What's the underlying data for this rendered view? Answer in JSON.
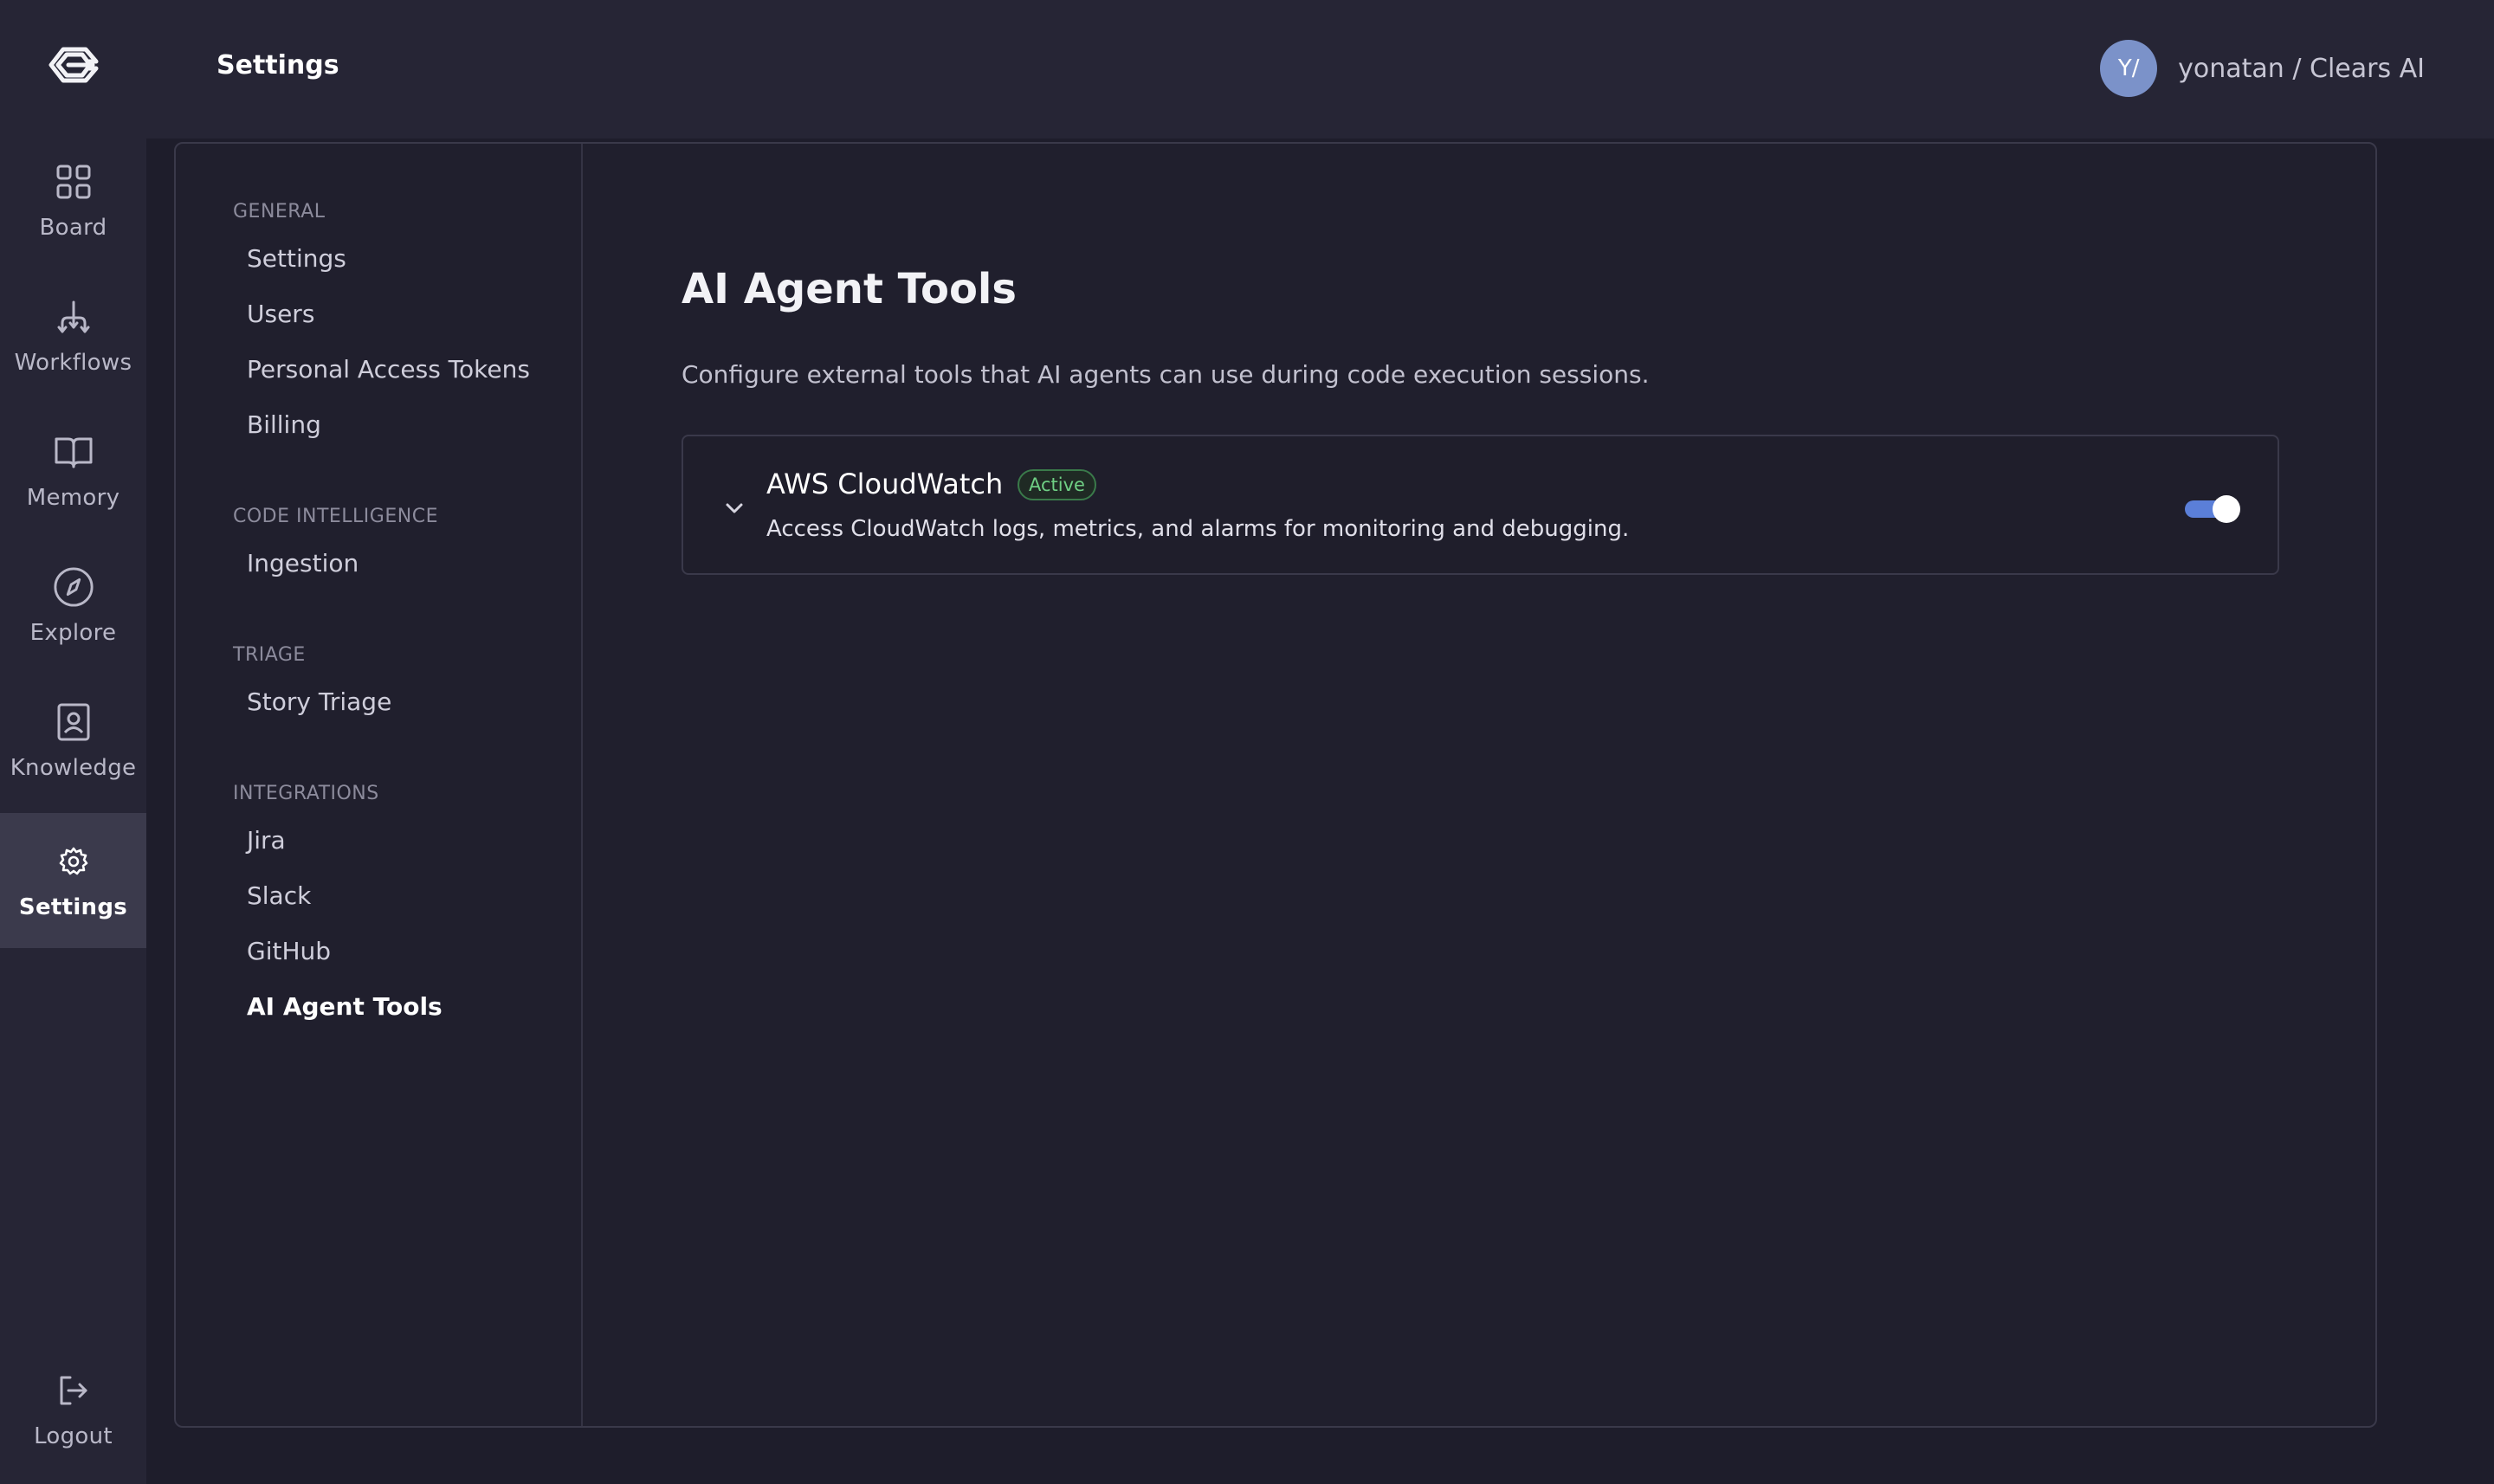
{
  "rail": {
    "items": [
      {
        "label": "Board",
        "icon": "board-icon"
      },
      {
        "label": "Workflows",
        "icon": "workflows-icon"
      },
      {
        "label": "Memory",
        "icon": "memory-icon"
      },
      {
        "label": "Explore",
        "icon": "explore-icon"
      },
      {
        "label": "Knowledge",
        "icon": "knowledge-icon"
      },
      {
        "label": "Settings",
        "icon": "gear-icon"
      }
    ],
    "logout": {
      "label": "Logout",
      "icon": "logout-icon"
    }
  },
  "header": {
    "title": "Settings",
    "user": {
      "initials": "Y/",
      "name": "yonatan / Clears AI"
    }
  },
  "subnav": {
    "groups": [
      {
        "title": "GENERAL",
        "items": [
          "Settings",
          "Users",
          "Personal Access Tokens",
          "Billing"
        ]
      },
      {
        "title": "CODE INTELLIGENCE",
        "items": [
          "Ingestion"
        ]
      },
      {
        "title": "TRIAGE",
        "items": [
          "Story Triage"
        ]
      },
      {
        "title": "INTEGRATIONS",
        "items": [
          "Jira",
          "Slack",
          "GitHub",
          "AI Agent Tools"
        ]
      }
    ],
    "active": "AI Agent Tools"
  },
  "content": {
    "title": "AI Agent Tools",
    "description": "Configure external tools that AI agents can use during code execution sessions.",
    "tools": [
      {
        "name": "AWS CloudWatch",
        "status": "Active",
        "description": "Access CloudWatch logs, metrics, and alarms for monitoring and debugging.",
        "enabled": true
      }
    ]
  },
  "colors": {
    "accent": "#5b7fd8",
    "active_badge": "#6fcf84"
  }
}
